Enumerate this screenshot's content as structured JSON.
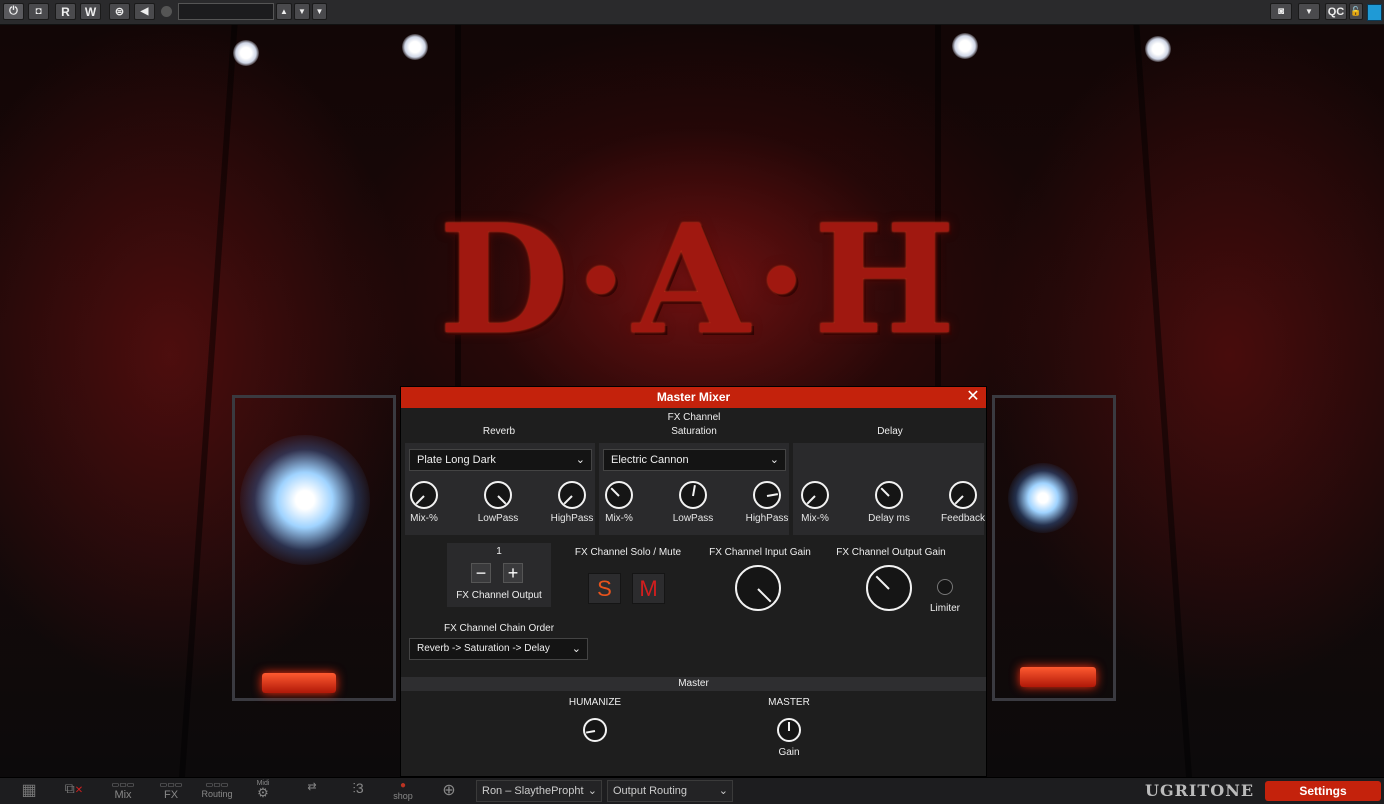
{
  "toolbar": {
    "buttons": [
      "R",
      "W"
    ],
    "preset_value": "",
    "right_label": "QC"
  },
  "stage": {
    "logo_text": "D·A·H"
  },
  "mixer": {
    "title": "Master Mixer",
    "close_icon": "close-icon",
    "section_header": "FX Channel",
    "reverb": {
      "label": "Reverb",
      "selected": "Plate Long Dark",
      "knobs": [
        {
          "label": "Mix-%",
          "value": 0.3
        },
        {
          "label": "LowPass",
          "value": 0.5
        },
        {
          "label": "HighPass",
          "value": 0.6
        }
      ]
    },
    "saturation": {
      "label": "Saturation",
      "selected": "Electric Cannon",
      "knobs": [
        {
          "label": "Mix-%",
          "value": 0.2
        },
        {
          "label": "LowPass",
          "value": 0.55
        },
        {
          "label": "HighPass",
          "value": 0.75
        }
      ]
    },
    "delay": {
      "label": "Delay",
      "knobs": [
        {
          "label": "Mix-%",
          "value": 0.3
        },
        {
          "label": "Delay ms",
          "value": 0.4
        },
        {
          "label": "Feedback",
          "value": 0.3
        }
      ]
    },
    "output": {
      "value": "1",
      "minus": "−",
      "plus": "+",
      "label": "FX Channel Output"
    },
    "solo_mute": {
      "label": "FX Channel Solo / Mute",
      "solo": "S",
      "mute": "M"
    },
    "input_gain": {
      "label": "FX Channel Input Gain",
      "value": 0.62
    },
    "output_gain": {
      "label": "FX Channel Output Gain",
      "value": 0.4
    },
    "limiter_label": "Limiter",
    "chain_order": {
      "label": "FX Channel Chain Order",
      "selected": "Reverb -> Saturation -> Delay"
    },
    "master": {
      "header": "Master",
      "humanize": {
        "label": "HUMANIZE",
        "value": 0.2
      },
      "master_label": "MASTER",
      "gain": {
        "label": "Gain",
        "value": 0.5
      }
    }
  },
  "bottombar": {
    "icons": [
      "Mix",
      "FX",
      "Routing",
      "Midi",
      "shop"
    ],
    "preset_select": "Ron – SlaythePropht",
    "output_routing": "Output Routing",
    "brand": "UGRITONE",
    "settings_label": "Settings"
  },
  "colors": {
    "accent": "#c4220c",
    "solo": "#e8531c",
    "mute": "#d21e1e"
  }
}
